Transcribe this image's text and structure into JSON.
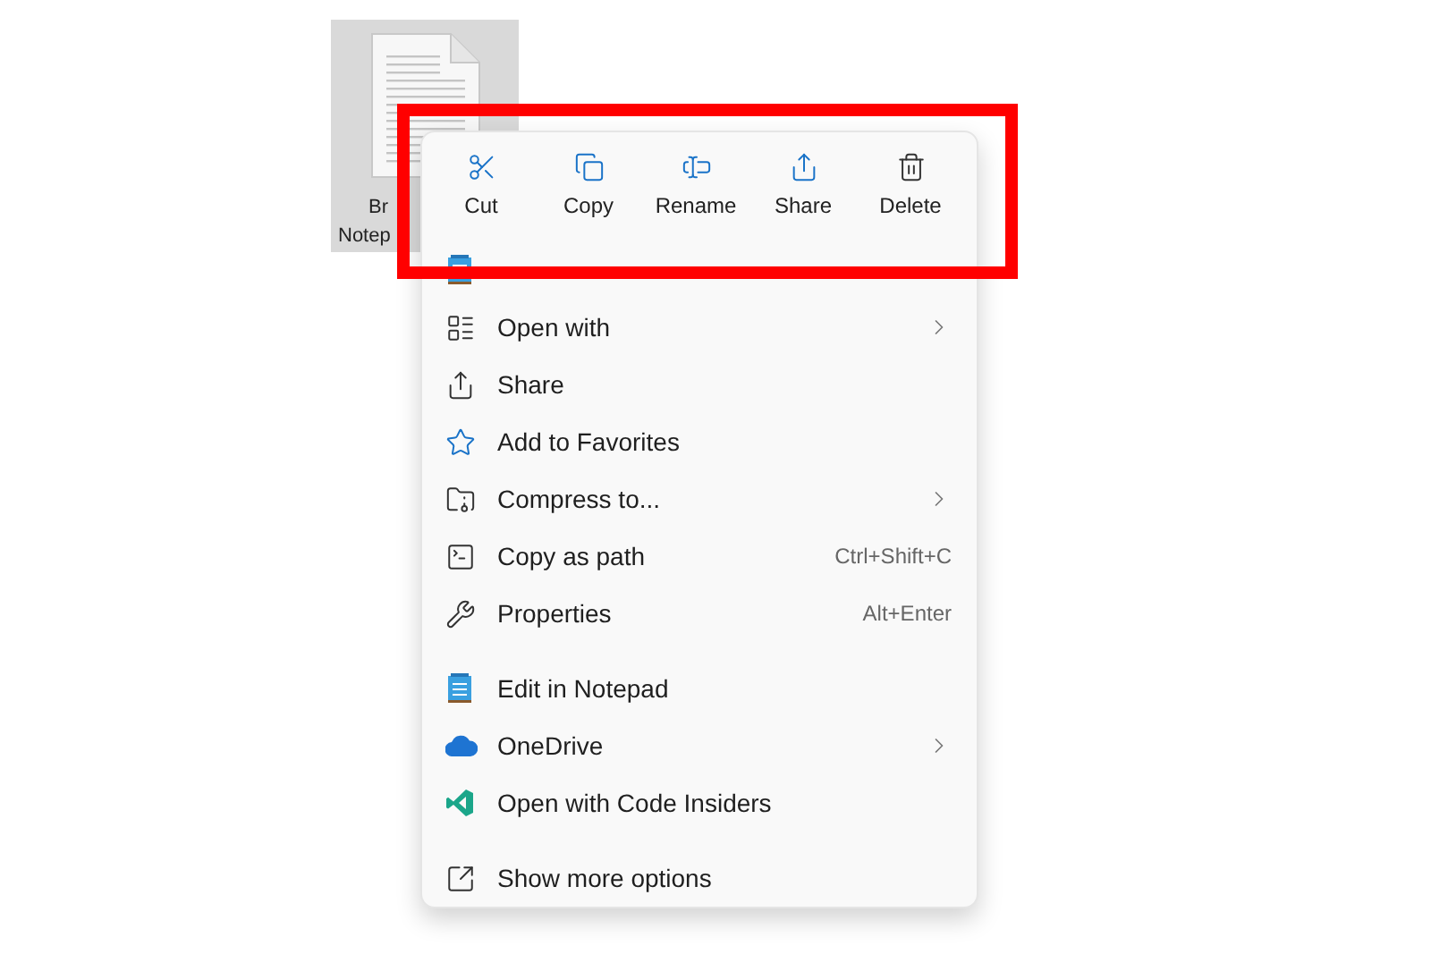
{
  "file": {
    "label_lines": [
      "Br",
      "Notep"
    ],
    "selected": true
  },
  "context_menu": {
    "toolbar": [
      {
        "label": "Cut"
      },
      {
        "label": "Copy"
      },
      {
        "label": "Rename"
      },
      {
        "label": "Share"
      },
      {
        "label": "Delete"
      }
    ],
    "sections": [
      {
        "items": [
          {
            "submenu": false
          },
          {
            "label": "Open with",
            "submenu": true
          },
          {
            "label": "Share",
            "submenu": false
          },
          {
            "label": "Add to Favorites",
            "submenu": false
          },
          {
            "label": "Compress to...",
            "submenu": true
          },
          {
            "label": "Copy as path",
            "shortcut": "Ctrl+Shift+C",
            "submenu": false
          },
          {
            "label": "Properties",
            "shortcut": "Alt+Enter",
            "submenu": false
          }
        ]
      },
      {
        "items": [
          {
            "label": "Edit in Notepad",
            "submenu": false
          },
          {
            "label": "OneDrive",
            "submenu": true
          },
          {
            "label": "Open with Code Insiders",
            "submenu": false
          }
        ]
      },
      {
        "items": [
          {
            "label": "Show more options",
            "submenu": false
          }
        ]
      }
    ]
  },
  "highlight": {
    "shown": true,
    "color": "#ff0000"
  }
}
